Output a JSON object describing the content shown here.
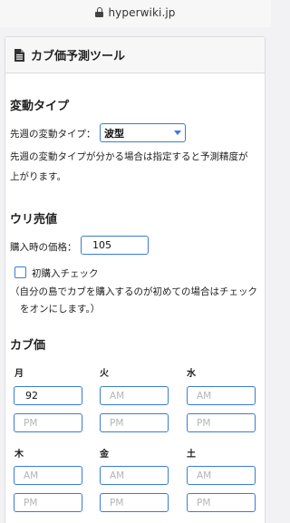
{
  "browser": {
    "url": "hyperwiki.jp"
  },
  "header": {
    "title": "カブ価予測ツール",
    "icon": "document-icon"
  },
  "pattern": {
    "heading": "変動タイプ",
    "select_label": "先週の変動タイプ：",
    "select_value": "波型",
    "help_line1": "先週の変動タイプが分かる場合は指定すると予測精度が",
    "help_line2": "上がります。"
  },
  "buy": {
    "heading": "ウリ売値",
    "price_label": "購入時の価格：",
    "price_value": "105",
    "first_buy_label": "初購入チェック",
    "note_line1": "（自分の島でカブを購入するのが初めての場合はチェック",
    "note_line2": "をオンにします。）"
  },
  "prices": {
    "heading": "カブ価",
    "am_placeholder": "AM",
    "pm_placeholder": "PM",
    "days": [
      {
        "label": "月",
        "am": "92",
        "pm": ""
      },
      {
        "label": "火",
        "am": "",
        "pm": ""
      },
      {
        "label": "水",
        "am": "",
        "pm": ""
      },
      {
        "label": "木",
        "am": "",
        "pm": ""
      },
      {
        "label": "金",
        "am": "",
        "pm": ""
      },
      {
        "label": "土",
        "am": "",
        "pm": ""
      }
    ]
  },
  "colors": {
    "accent": "#3a7bd5",
    "placeholder": "#b5b5b5"
  }
}
